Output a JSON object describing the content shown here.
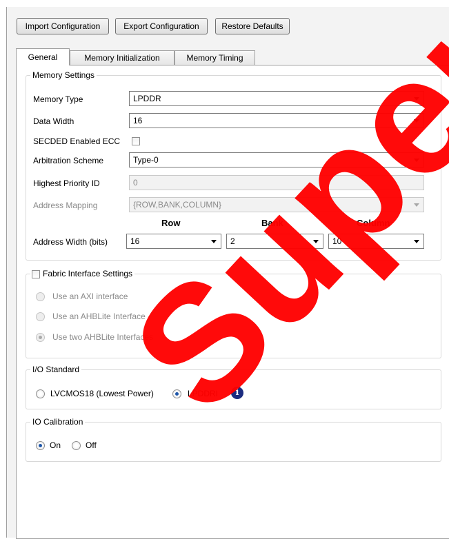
{
  "toolbar": {
    "import_label": "Import Configuration",
    "export_label": "Export Configuration",
    "restore_label": "Restore Defaults"
  },
  "tabs": [
    {
      "label": "General",
      "active": true
    },
    {
      "label": "Memory Initialization",
      "active": false
    },
    {
      "label": "Memory Timing",
      "active": false
    }
  ],
  "memory_settings": {
    "legend": "Memory Settings",
    "memory_type": {
      "label": "Memory Type",
      "value": "LPDDR"
    },
    "data_width": {
      "label": "Data Width",
      "value": "16"
    },
    "secded": {
      "label": "SECDED Enabled ECC",
      "checked": false
    },
    "arbitration": {
      "label": "Arbitration Scheme",
      "value": "Type-0"
    },
    "highest_priority": {
      "label": "Highest Priority ID",
      "value": "0"
    },
    "address_mapping": {
      "label": "Address Mapping",
      "value": "{ROW,BANK,COLUMN}"
    },
    "columns": {
      "row": "Row",
      "bank": "Bank",
      "column": "Column"
    },
    "address_width": {
      "label": "Address Width (bits)",
      "row": "16",
      "bank": "2",
      "column": "10"
    }
  },
  "fabric": {
    "legend": "Fabric Interface Settings",
    "checked": false,
    "options": [
      {
        "label": "Use an AXI interface",
        "selected": false
      },
      {
        "label": "Use an AHBLite Interface",
        "selected": false
      },
      {
        "label": "Use two AHBLite Interfaces",
        "selected": true
      }
    ]
  },
  "io_standard": {
    "legend": "I/O Standard",
    "options": [
      {
        "label": "LVCMOS18 (Lowest Power)",
        "selected": false
      },
      {
        "label": "LPDDRI",
        "selected": true
      }
    ],
    "info_glyph": "i"
  },
  "io_calibration": {
    "legend": "IO Calibration",
    "options": [
      {
        "label": "On",
        "selected": true
      },
      {
        "label": "Off",
        "selected": false
      }
    ]
  },
  "watermark": {
    "text": "Superseded",
    "color": "#ff0000"
  }
}
